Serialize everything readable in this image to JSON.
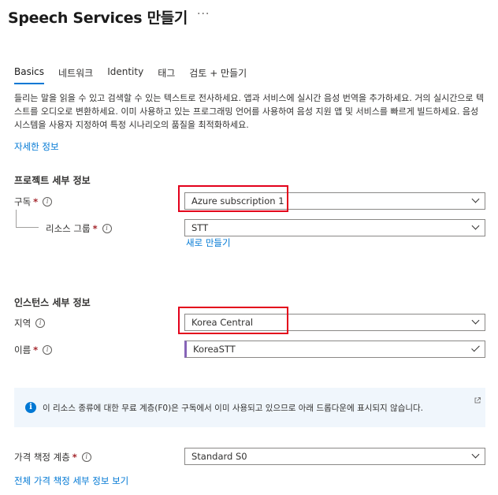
{
  "header": {
    "title": "Speech Services 만들기",
    "more": "···"
  },
  "tabs": [
    {
      "label": "Basics"
    },
    {
      "label": "네트워크"
    },
    {
      "label": "Identity"
    },
    {
      "label": "태그"
    },
    {
      "label": "검토 + 만들기"
    }
  ],
  "description": "들리는 말을 읽을 수 있고 검색할 수 있는 텍스트로 전사하세요. 앱과 서비스에 실시간 음성 번역을 추가하세요. 거의 실시간으로 텍스트를 오디오로 변환하세요. 이미 사용하고 있는 프로그래밍 언어를 사용하여 음성 지원 앱 및 서비스를 빠르게 빌드하세요. 음성 시스템을 사용자 지정하여 특정 시나리오의 품질을 최적화하세요.",
  "learn_more": "자세한 정보",
  "project": {
    "header": "프로젝트 세부 정보",
    "subscription": {
      "label": "구독",
      "required": "*",
      "value": "Azure subscription 1"
    },
    "resource_group": {
      "label": "리소스 그룹",
      "required": "*",
      "value": "STT",
      "create_new": "새로 만들기"
    }
  },
  "instance": {
    "header": "인스턴스 세부 정보",
    "region": {
      "label": "지역",
      "value": "Korea Central"
    },
    "name": {
      "label": "이름",
      "required": "*",
      "value": "KoreaSTT"
    }
  },
  "banner": {
    "text": "이 리소스 종류에 대한 무료 계층(F0)은 구독에서 이미 사용되고 있으므로 아래 드롭다운에 표시되지 않습니다."
  },
  "pricing": {
    "label": "가격 책정 계층",
    "required": "*",
    "value": "Standard S0",
    "details_link": "전체 가격 책정 세부 정보 보기"
  },
  "colors": {
    "accent": "#0078d4",
    "highlight": "#e3001b",
    "required": "#a4262c",
    "banner_bg": "#f0f6fc"
  }
}
